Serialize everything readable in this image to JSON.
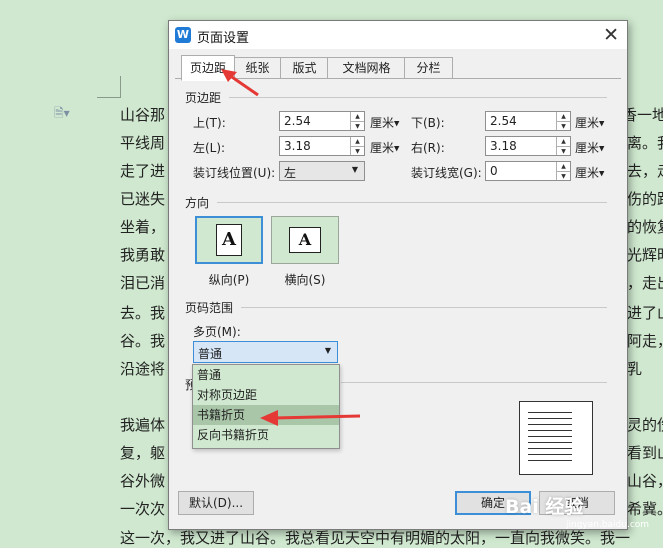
{
  "document": {
    "lines": [
      "山谷那",
      "平线周",
      "走了进",
      "已迷失",
      "坐着，",
      "我勇敢",
      "泪已消",
      "去。我",
      "谷。我",
      "沿途将",
      "我遍体",
      "复，躯",
      "谷外微",
      "一次次",
      "这一次，我又进了山谷。我总看见天空中有明媚的太阳，一直向我微笑。我一"
    ],
    "right_fragments": [
      "香一地",
      "离。我",
      "去，走",
      "伤的跟",
      "的恢复",
      "光辉时",
      "，走出",
      "进了山",
      "阿走，",
      "乳",
      "灵的伤",
      "看到山",
      "山谷，",
      "希冀。"
    ]
  },
  "dialog": {
    "app_icon": "W",
    "title": "页面设置",
    "close_label": "✕",
    "tabs": [
      {
        "label": "页边距",
        "active": true
      },
      {
        "label": "纸张",
        "active": false
      },
      {
        "label": "版式",
        "active": false
      },
      {
        "label": "文档网格",
        "active": false
      },
      {
        "label": "分栏",
        "active": false
      }
    ],
    "margins": {
      "section_label": "页边距",
      "top_label": "上(T):",
      "top_value": "2.54",
      "bottom_label": "下(B):",
      "bottom_value": "2.54",
      "left_label": "左(L):",
      "left_value": "3.18",
      "right_label": "右(R):",
      "right_value": "3.18",
      "unit": "厘米",
      "gutter_pos_label": "装订线位置(U):",
      "gutter_pos_value": "左",
      "gutter_width_label": "装订线宽(G):",
      "gutter_width_value": "0"
    },
    "orientation": {
      "section_label": "方向",
      "portrait_label": "纵向(P)",
      "landscape_label": "横向(S)",
      "page_glyph": "A"
    },
    "page_range": {
      "section_label": "页码范围",
      "multiple_label": "多页(M):",
      "selected": "普通",
      "options": [
        "普通",
        "对称页边距",
        "书籍折页",
        "反向书籍折页"
      ],
      "highlighted": "书籍折页"
    },
    "preview": {
      "section_label_partial": "预"
    },
    "buttons": {
      "default_label": "默认(D)...",
      "ok_label": "确定",
      "cancel_label": "取消"
    }
  },
  "watermark": {
    "text": "Bai 经验",
    "sub": "jingyan.baidu.com"
  },
  "colors": {
    "background": "#cfe8cf",
    "accent": "#3c8fd6",
    "arrow": "#e53935"
  }
}
